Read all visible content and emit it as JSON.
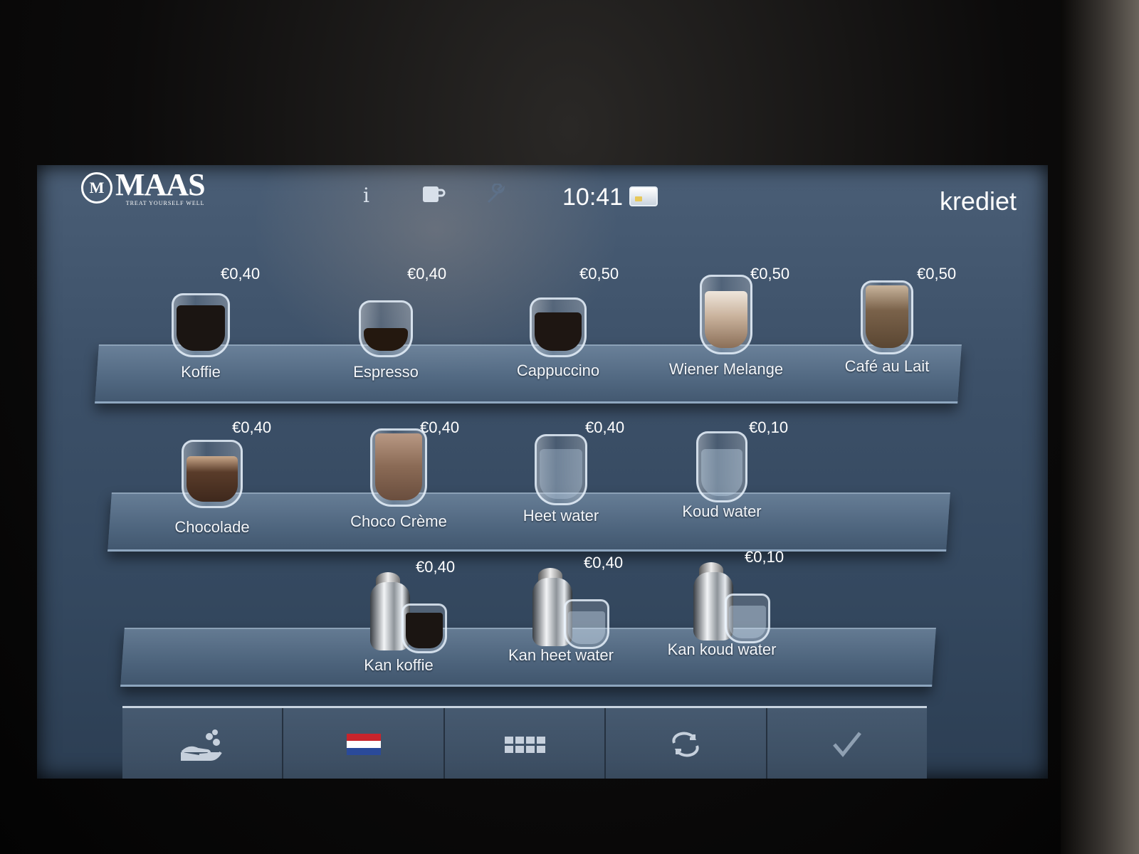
{
  "header": {
    "logo_text": "MAAS",
    "logo_badge": "M",
    "logo_tagline": "TREAT YOURSELF WELL",
    "info_icon": "i",
    "cup_icon": "cup-icon",
    "wrench_icon": "wrench-icon",
    "time": "10:41",
    "card_icon": "card-icon",
    "credit_label": "krediet"
  },
  "shelves": [
    {
      "products": [
        {
          "name": "Koffie",
          "price": "€0,40",
          "fill": "#1b1512"
        },
        {
          "name": "Espresso",
          "price": "€0,40",
          "fill": "#24180f"
        },
        {
          "name": "Cappuccino",
          "price": "€0,50",
          "fill": "#1e1612"
        },
        {
          "name": "Wiener Melange",
          "price": "€0,50",
          "fill": "#b59c86"
        },
        {
          "name": "Café au Lait",
          "price": "€0,50",
          "fill": "#6b5640"
        }
      ]
    },
    {
      "products": [
        {
          "name": "Chocolade",
          "price": "€0,40",
          "fill": "#4a3426"
        },
        {
          "name": "Choco Crème",
          "price": "€0,40",
          "fill": "#8a6a55"
        },
        {
          "name": "Heet water",
          "price": "€0,40",
          "fill": "#9fb6cc"
        },
        {
          "name": "Koud water",
          "price": "€0,10",
          "fill": "#a5bbd0"
        }
      ]
    },
    {
      "products": [
        {
          "name": "Kan koffie",
          "price": "€0,40",
          "fill": "#1b1512"
        },
        {
          "name": "Kan heet water",
          "price": "€0,40",
          "fill": "#b8c8d8"
        },
        {
          "name": "Kan koud water",
          "price": "€0,10",
          "fill": "#b8c8d8"
        }
      ]
    }
  ],
  "bottombar": {
    "buttons": [
      "donate-icon",
      "flag-nl-icon",
      "grid-icon",
      "refresh-icon",
      "checkmark-icon"
    ],
    "flag_colors": [
      "#c8242c",
      "#ffffff",
      "#2a4a9a"
    ]
  }
}
